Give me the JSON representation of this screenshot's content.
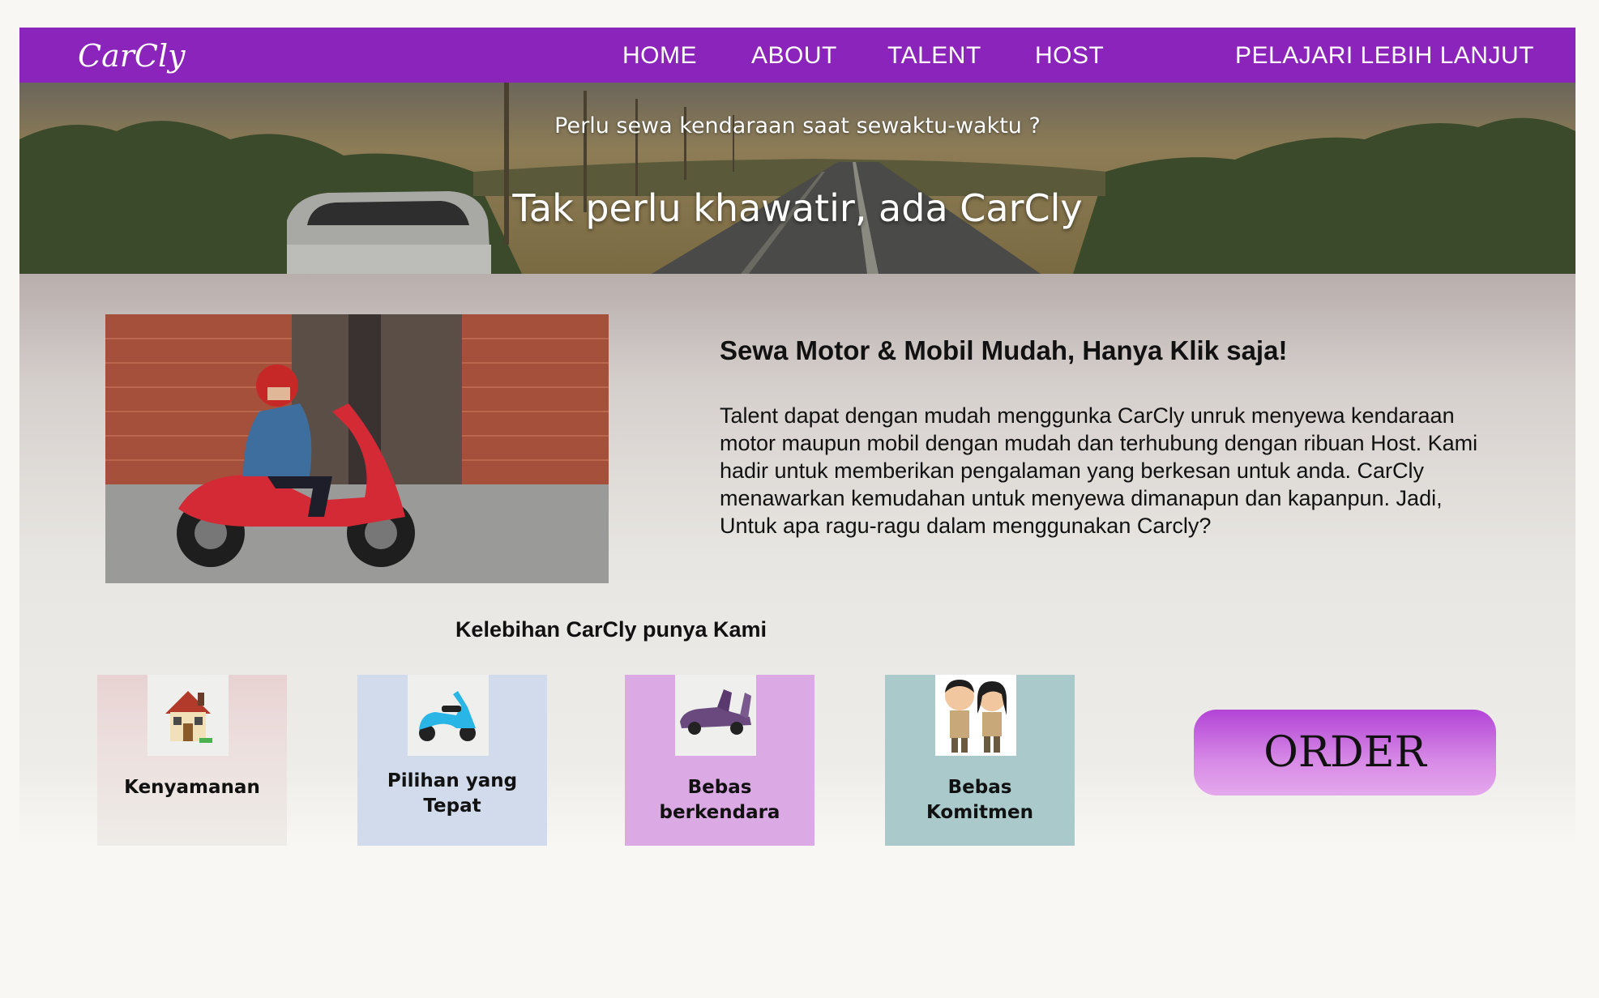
{
  "nav": {
    "logo": "CarCly",
    "links": [
      "HOME",
      "ABOUT",
      "TALENT",
      "HOST"
    ],
    "cta": "PELAJARI LEBIH LANJUT",
    "bg_color": "#8a24bb"
  },
  "hero": {
    "subtitle": "Perlu sewa kendaraan saat sewaktu-waktu ?",
    "title": "Tak perlu khawatir, ada CarCly"
  },
  "about": {
    "heading": "Sewa Motor & Mobil Mudah, Hanya Klik saja!",
    "paragraph": "Talent dapat dengan mudah menggunka CarCly unruk menyewa kendaraan motor maupun mobil dengan mudah dan terhubung dengan ribuan Host. Kami hadir untuk memberikan pengalaman yang berkesan untuk anda. CarCly menawarkan kemudahan untuk menyewa dimanapun dan kapanpun. Jadi, Untuk apa ragu-ragu dalam menggunakan Carcly?"
  },
  "features": {
    "title": "Kelebihan CarCly punya Kami",
    "items": [
      {
        "label_line1": "Kenyamanan",
        "label_line2": "",
        "icon": "house-icon",
        "color": "#e8d4d4"
      },
      {
        "label_line1": "Pilihan yang",
        "label_line2": "Tepat",
        "icon": "scooter-icon",
        "color": "#d2dbec"
      },
      {
        "label_line1": "Bebas",
        "label_line2": "berkendara",
        "icon": "sports-car-icon",
        "color": "#dba9e4"
      },
      {
        "label_line1": "Bebas",
        "label_line2": "Komitmen",
        "icon": "couple-icon",
        "color": "#a9c9cb"
      }
    ]
  },
  "order_button": "ORDER"
}
